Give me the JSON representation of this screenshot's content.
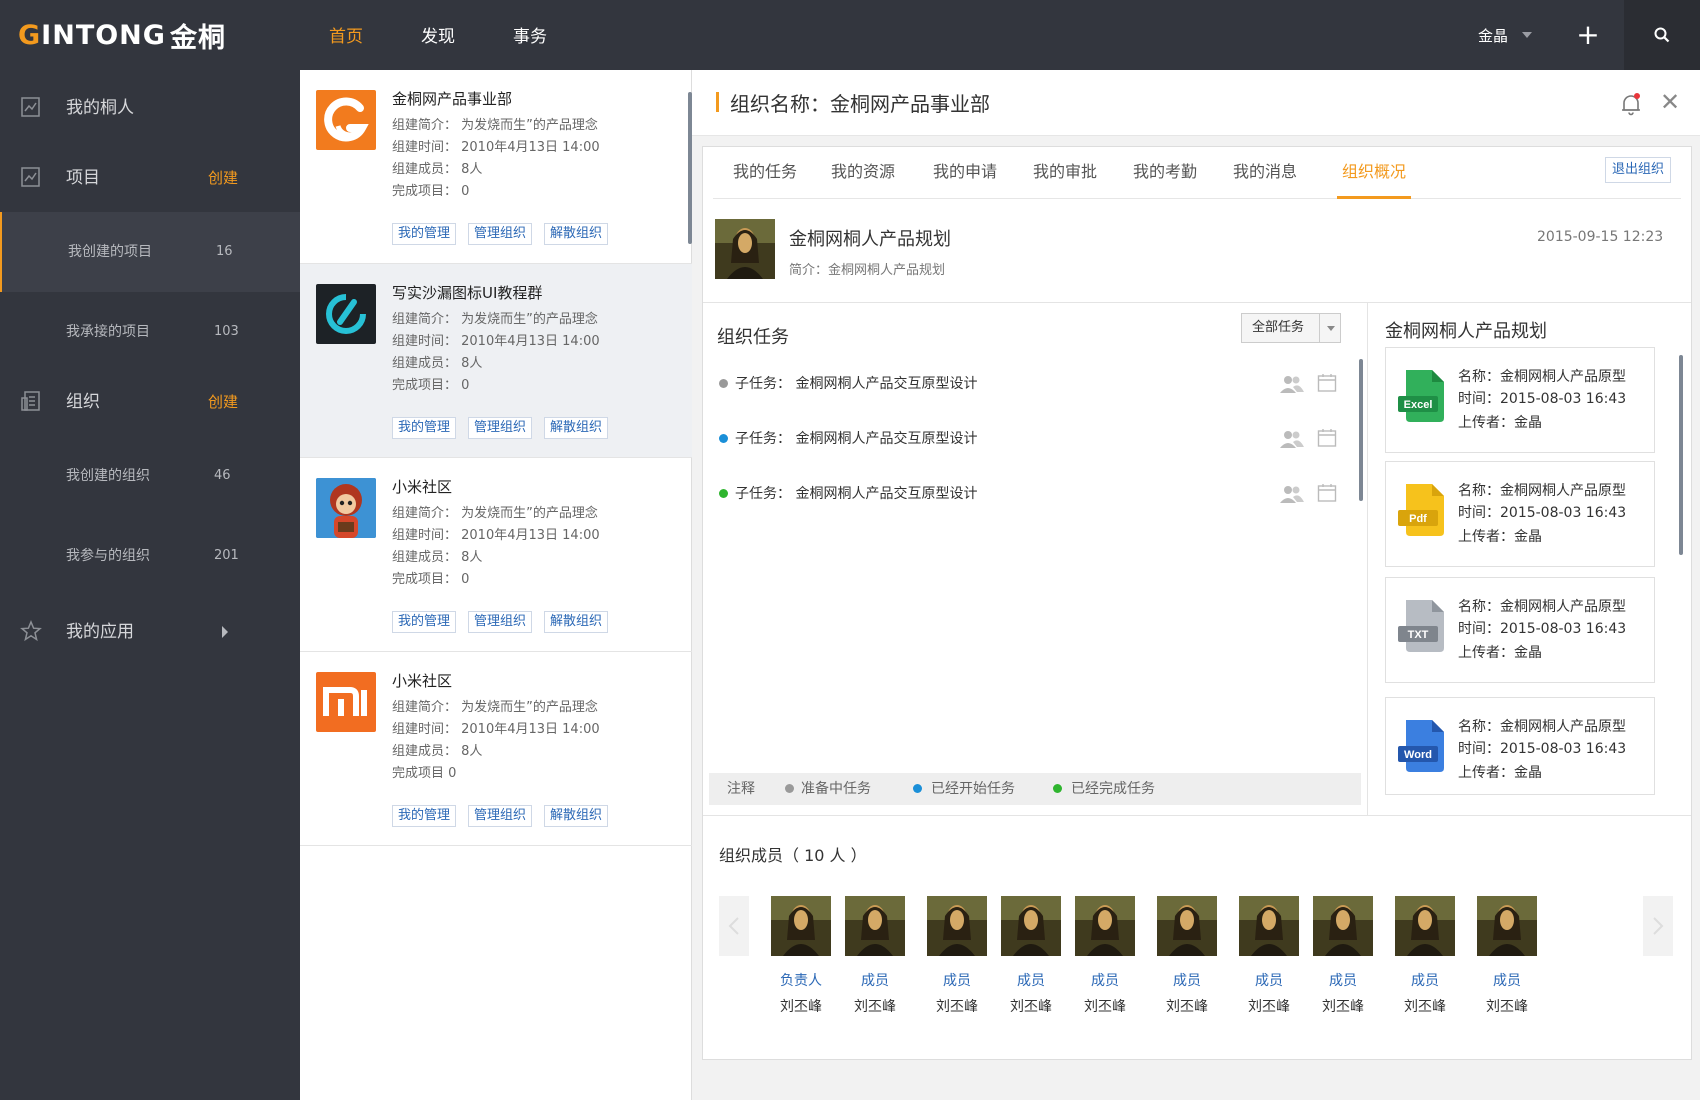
{
  "brand": {
    "logo_g": "G",
    "logo_text": "INTONG",
    "logo_cn": "金桐"
  },
  "topnav": {
    "items": [
      "首页",
      "发现",
      "事务"
    ],
    "active": 0
  },
  "user": {
    "name": "金晶"
  },
  "icons": {
    "plus": "+",
    "search": "search-icon"
  },
  "sidebar": {
    "people": "我的桐人",
    "project": {
      "label": "项目",
      "action": "创建"
    },
    "project_subs": [
      {
        "label": "我创建的项目",
        "count": "16"
      },
      {
        "label": "我承接的项目",
        "count": "103"
      }
    ],
    "org": {
      "label": "组织",
      "action": "创建"
    },
    "org_subs": [
      {
        "label": "我创建的组织",
        "count": "46"
      },
      {
        "label": "我参与的组织",
        "count": "201"
      }
    ],
    "apps": "我的应用"
  },
  "orgs": [
    {
      "name": "金桐网产品事业部",
      "intro": "组建简介： 为发烧而生”的产品理念",
      "time": "组建时间： 2010年4月13日  14:00",
      "members": "组建成员： 8人",
      "done": "完成项目：  0",
      "logo": "gintong"
    },
    {
      "name": "写实沙漏图标UI教程群",
      "intro": "组建简介： 为发烧而生”的产品理念",
      "time": "组建时间： 2010年4月13日  14:00",
      "members": "组建成员： 8人",
      "done": "完成项目：  0",
      "logo": "hourglass"
    },
    {
      "name": "小米社区",
      "intro": "组建简介： 为发烧而生”的产品理念",
      "time": "组建时间： 2010年4月13日  14:00",
      "members": "组建成员： 8人",
      "done": "完成项目：  0",
      "logo": "cartoon"
    },
    {
      "name": "小米社区",
      "intro": "组建简介： 为发烧而生”的产品理念",
      "time": "组建时间： 2010年4月13日  14:00",
      "members": "组建成员： 8人",
      "done": "完成项目      0",
      "logo": "mi"
    }
  ],
  "org_buttons": [
    "我的管理",
    "管理组织",
    "解散组织"
  ],
  "detail": {
    "title": "组织名称：金桐网产品事业部",
    "tabs": [
      "我的任务",
      "我的资源",
      "我的申请",
      "我的审批",
      "我的考勤",
      "我的消息",
      "组织概况"
    ],
    "active_tab": 6,
    "quit": "退出组织",
    "project": {
      "name": "金桐网桐人产品规划",
      "desc": "简介：金桐网桐人产品规划",
      "time": "2015-09-15  12:23"
    },
    "tasks_title": "组织任务",
    "filter": "全部任务",
    "tasks": [
      {
        "label": "子任务：  金桐网桐人产品交互原型设计",
        "status": "grey"
      },
      {
        "label": "子任务：  金桐网桐人产品交互原型设计",
        "status": "blue"
      },
      {
        "label": "子任务：  金桐网桐人产品交互原型设计",
        "status": "green"
      }
    ],
    "legend": {
      "note": "注释",
      "items": [
        "准备中任务",
        "已经开始任务",
        "已经完成任务"
      ]
    },
    "files_title": "金桐网桐人产品规划",
    "files": [
      {
        "type": "Excel",
        "name": "名称：金桐网桐人产品原型",
        "time": "时间：2015-08-03 16:43",
        "uploader": "上传者：金晶"
      },
      {
        "type": "Pdf",
        "name": "名称：金桐网桐人产品原型",
        "time": "时间：2015-08-03 16:43",
        "uploader": "上传者：金晶"
      },
      {
        "type": "TXT",
        "name": "名称：金桐网桐人产品原型",
        "time": "时间：2015-08-03 16:43",
        "uploader": "上传者：金晶"
      },
      {
        "type": "Word",
        "name": "名称：金桐网桐人产品原型",
        "time": "时间：2015-08-03 16:43",
        "uploader": "上传者：金晶"
      }
    ],
    "members_title": "组织成员（ 10 人 ）",
    "members": [
      {
        "role": "负责人",
        "name": "刘丕峰"
      },
      {
        "role": "成员",
        "name": "刘丕峰"
      },
      {
        "role": "成员",
        "name": "刘丕峰"
      },
      {
        "role": "成员",
        "name": "刘丕峰"
      },
      {
        "role": "成员",
        "name": "刘丕峰"
      },
      {
        "role": "成员",
        "name": "刘丕峰"
      },
      {
        "role": "成员",
        "name": "刘丕峰"
      },
      {
        "role": "成员",
        "name": "刘丕峰"
      },
      {
        "role": "成员",
        "name": "刘丕峰"
      },
      {
        "role": "成员",
        "name": "刘丕峰"
      }
    ]
  },
  "colors": {
    "accent": "#f39a1e",
    "dark": "#33363e",
    "link": "#2b68b6",
    "status_grey": "#999999",
    "status_blue": "#1a8fd8",
    "status_green": "#2fb52f"
  }
}
